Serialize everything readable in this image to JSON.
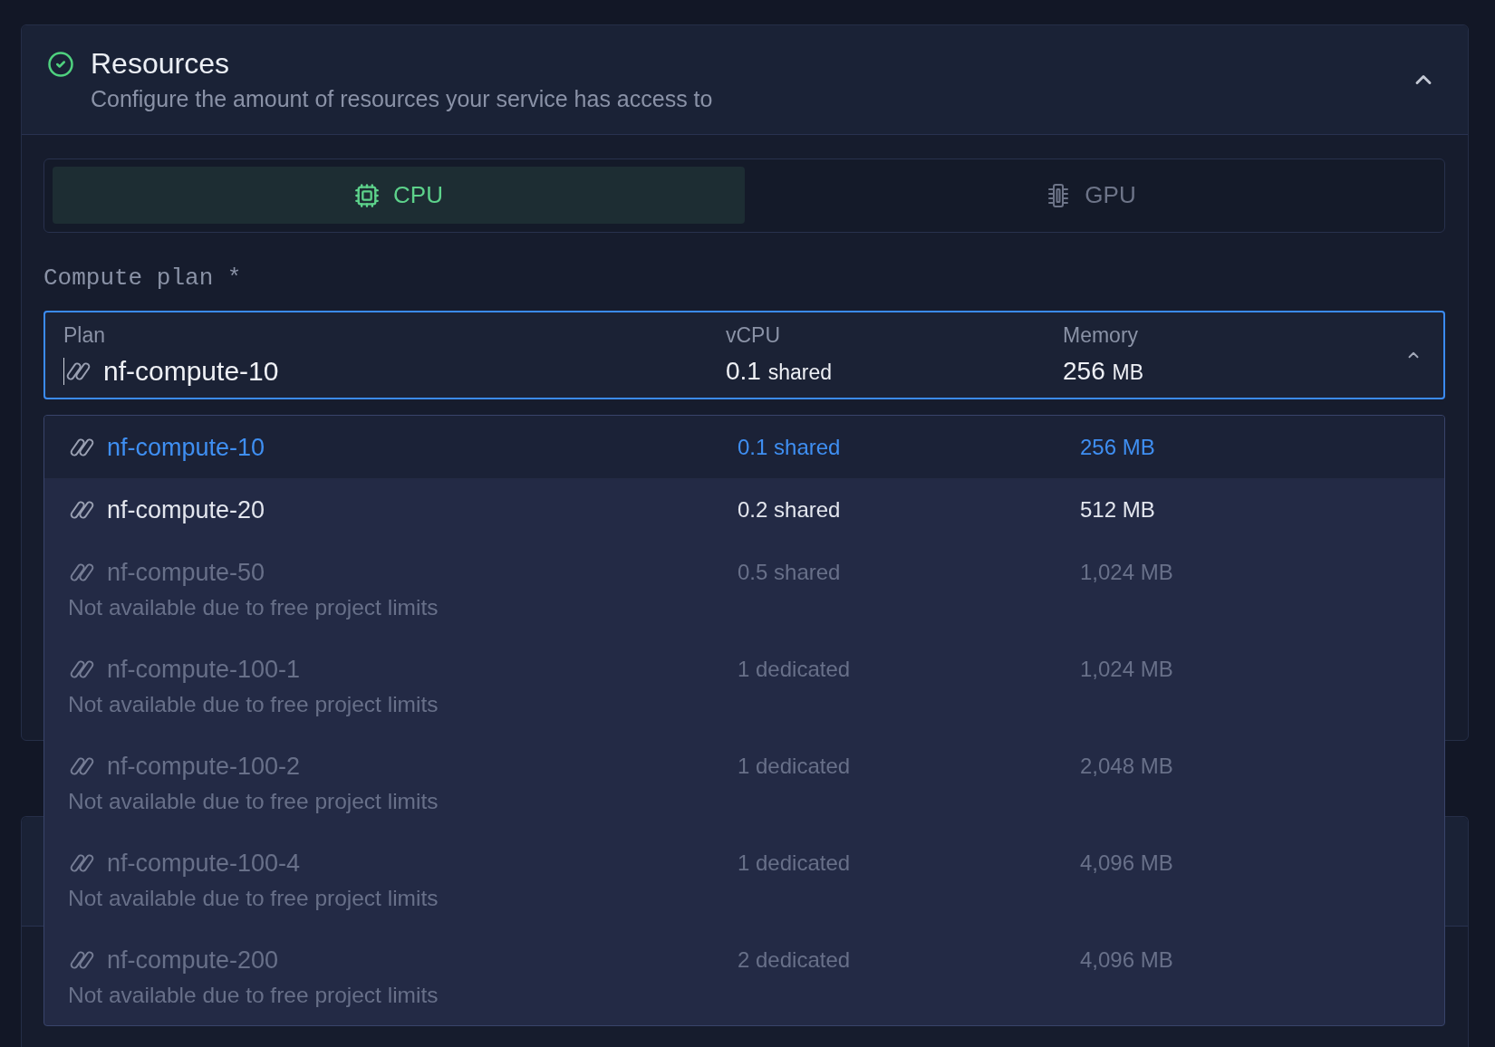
{
  "section": {
    "title": "Resources",
    "subtitle": "Configure the amount of resources your service has access to",
    "complete": true,
    "expanded": true
  },
  "tabs": [
    {
      "kind": "cpu",
      "label": "CPU",
      "selected": true
    },
    {
      "kind": "gpu",
      "label": "GPU",
      "selected": false
    }
  ],
  "compute_plan": {
    "label": "Compute plan *",
    "columns": [
      "Plan",
      "vCPU",
      "Memory"
    ],
    "value": {
      "plan": "nf-compute-10",
      "vcpu": "0.1",
      "vcpu_unit": "shared",
      "memory": "256",
      "memory_unit": "MB"
    },
    "open": true,
    "options": [
      {
        "plan": "nf-compute-10",
        "vcpu": "0.1 shared",
        "memory": "256 MB",
        "selected": true,
        "disabled": false
      },
      {
        "plan": "nf-compute-20",
        "vcpu": "0.2 shared",
        "memory": "512 MB",
        "selected": false,
        "disabled": false
      },
      {
        "plan": "nf-compute-50",
        "vcpu": "0.5 shared",
        "memory": "1,024 MB",
        "selected": false,
        "disabled": true,
        "note": "Not available due to free project limits"
      },
      {
        "plan": "nf-compute-100-1",
        "vcpu": "1 dedicated",
        "memory": "1,024 MB",
        "selected": false,
        "disabled": true,
        "note": "Not available due to free project limits"
      },
      {
        "plan": "nf-compute-100-2",
        "vcpu": "1 dedicated",
        "memory": "2,048 MB",
        "selected": false,
        "disabled": true,
        "note": "Not available due to free project limits"
      },
      {
        "plan": "nf-compute-100-4",
        "vcpu": "1 dedicated",
        "memory": "4,096 MB",
        "selected": false,
        "disabled": true,
        "note": "Not available due to free project limits"
      },
      {
        "plan": "nf-compute-200",
        "vcpu": "2 dedicated",
        "memory": "4,096 MB",
        "selected": false,
        "disabled": true,
        "note": "Not available due to free project limits"
      }
    ]
  }
}
